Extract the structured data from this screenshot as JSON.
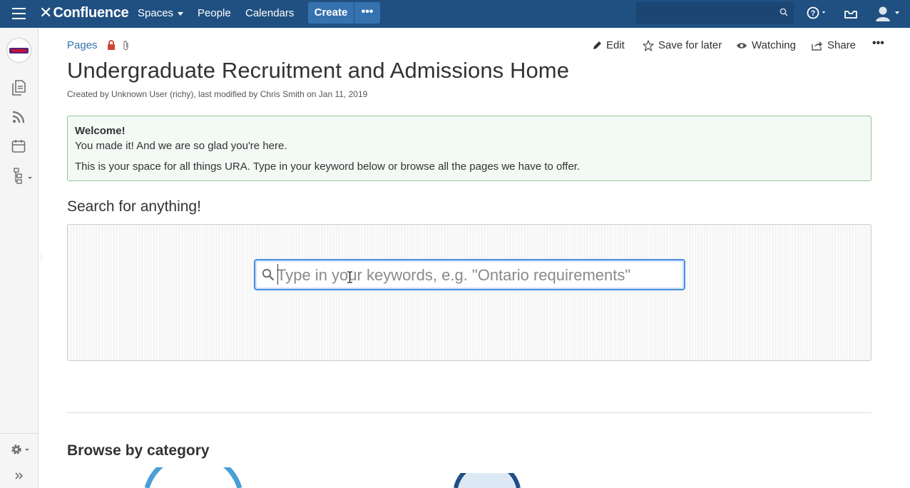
{
  "topnav": {
    "logo_text": "Confluence",
    "spaces_label": "Spaces",
    "people_label": "People",
    "calendars_label": "Calendars",
    "create_label": "Create",
    "more_label": "•••",
    "search_placeholder": "",
    "bg_color": "#205081"
  },
  "sidebar": {
    "icons": [
      "space-logo-icon",
      "pages-icon",
      "blog-feed-icon",
      "calendar-icon",
      "hierarchy-icon",
      "settings-gear-icon",
      "expand-sidebar-icon"
    ]
  },
  "page": {
    "breadcrumb": "Pages",
    "actions": {
      "edit": "Edit",
      "save_for_later": "Save for later",
      "watching": "Watching",
      "share": "Share",
      "more": "•••"
    },
    "title": "Undergraduate Recruitment and Admissions Home",
    "byline": "Created by Unknown User (richy), last modified by Chris Smith on Jan 11, 2019",
    "welcome": {
      "heading": "Welcome!",
      "line1": "You made it! And we are so glad you're here.",
      "line2": "This is your space for all things URA. Type in your keyword below or browse all the pages we have to offer."
    },
    "search_heading": "Search for anything!",
    "search_placeholder": "Type in your keywords, e.g. \"Ontario requirements\"",
    "browse_heading": "Browse by category"
  }
}
